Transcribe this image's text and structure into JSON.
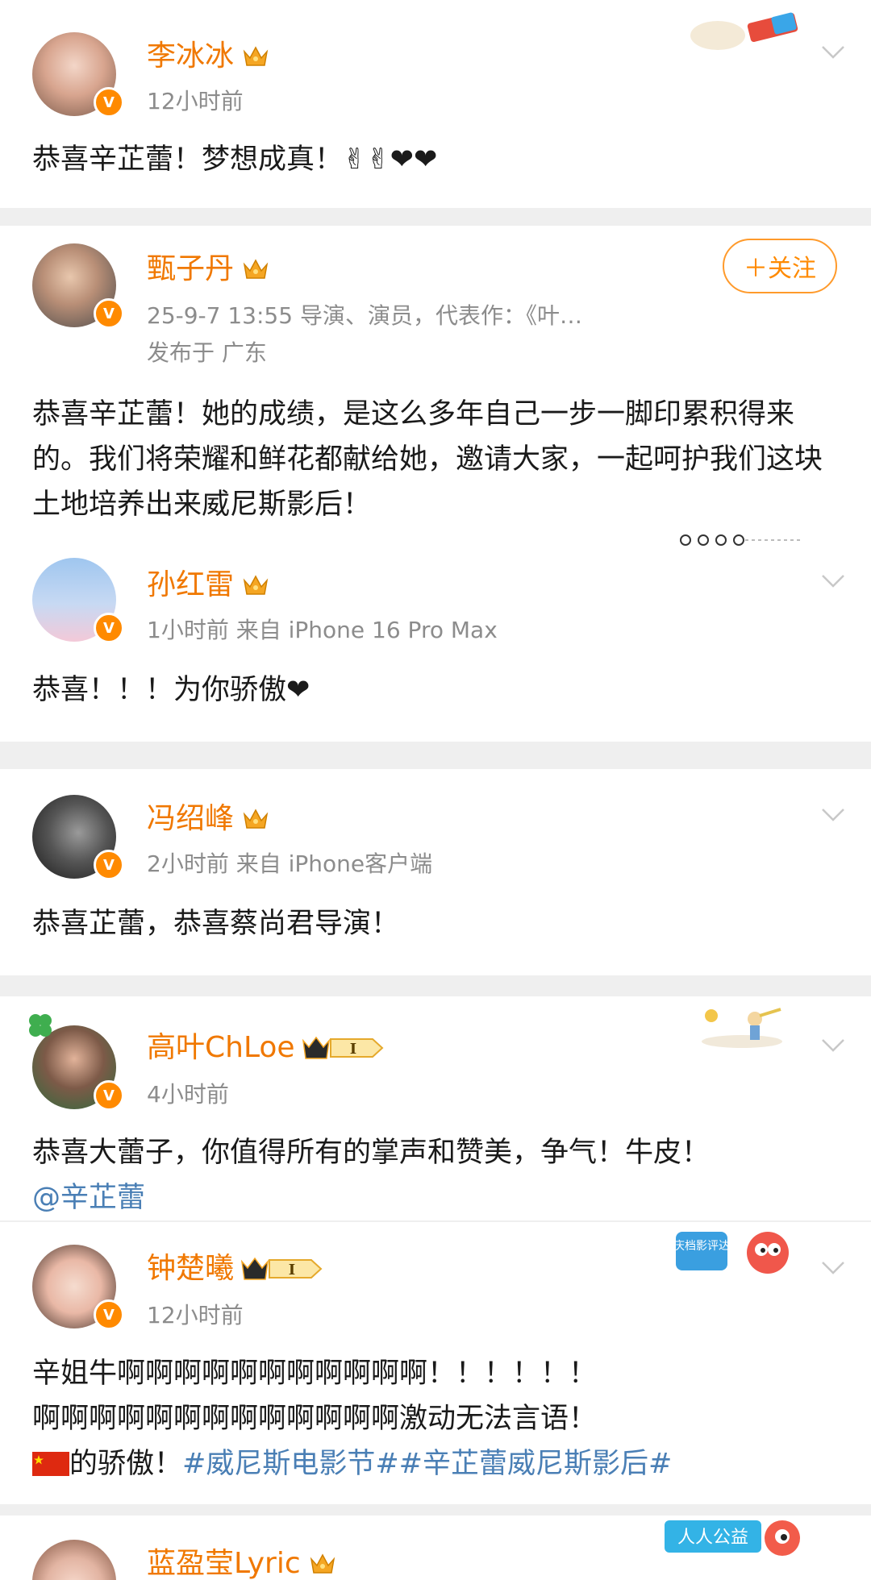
{
  "posts": [
    {
      "name": "李冰冰",
      "meta": "12小时前",
      "text": "恭喜辛芷蕾！梦想成真！✌✌❤❤"
    },
    {
      "name": "甄子丹",
      "meta": "25-9-7 13:55  导演、演员，代表作：《叶…",
      "meta2": "发布于 广东",
      "follow": "＋关注",
      "text": "恭喜辛芷蕾！她的成绩，是这么多年自己一步一脚印累积得来的。我们将荣耀和鲜花都献给她，邀请大家，一起呵护我们这块土地培养出来威尼斯影后！"
    },
    {
      "name": "孙红雷",
      "meta": "1小时前  来自 iPhone 16 Pro Max",
      "text": "恭喜！！！为你骄傲❤"
    },
    {
      "name": "冯绍峰",
      "meta": "2小时前  来自 iPhone客户端",
      "text": "恭喜芷蕾，恭喜蔡尚君导演！"
    },
    {
      "name": "高叶ChLoe",
      "rank": "I",
      "meta": "4小时前",
      "text": "恭喜大蕾子，你值得所有的掌声和赞美，争气！牛皮！",
      "mention": "@辛芷蕾"
    },
    {
      "name": "钟楚曦",
      "rank": "I",
      "meta": "12小时前",
      "text_line1": "辛姐牛啊啊啊啊啊啊啊啊啊啊啊！！！！！！",
      "text_line2": "啊啊啊啊啊啊啊啊啊啊啊啊啊激动无法言语！",
      "text_line3_prefix": "的骄傲！",
      "topic": "#威尼斯电影节##辛芷蕾威尼斯影后#"
    },
    {
      "name": "蓝盈莹Lyric"
    }
  ],
  "stickers": {
    "sticker_1": "国庆档影评达人",
    "sticker_2": "人人公益"
  },
  "colors": {
    "name": "#f07800",
    "meta": "#8c8c8c",
    "link": "#4a7fb5",
    "separator": "#efefef",
    "vbadge": "#ff8a00"
  },
  "icons": [
    "v-verified-icon",
    "crown-icon",
    "chevron-down-icon",
    "china-flag-icon"
  ]
}
